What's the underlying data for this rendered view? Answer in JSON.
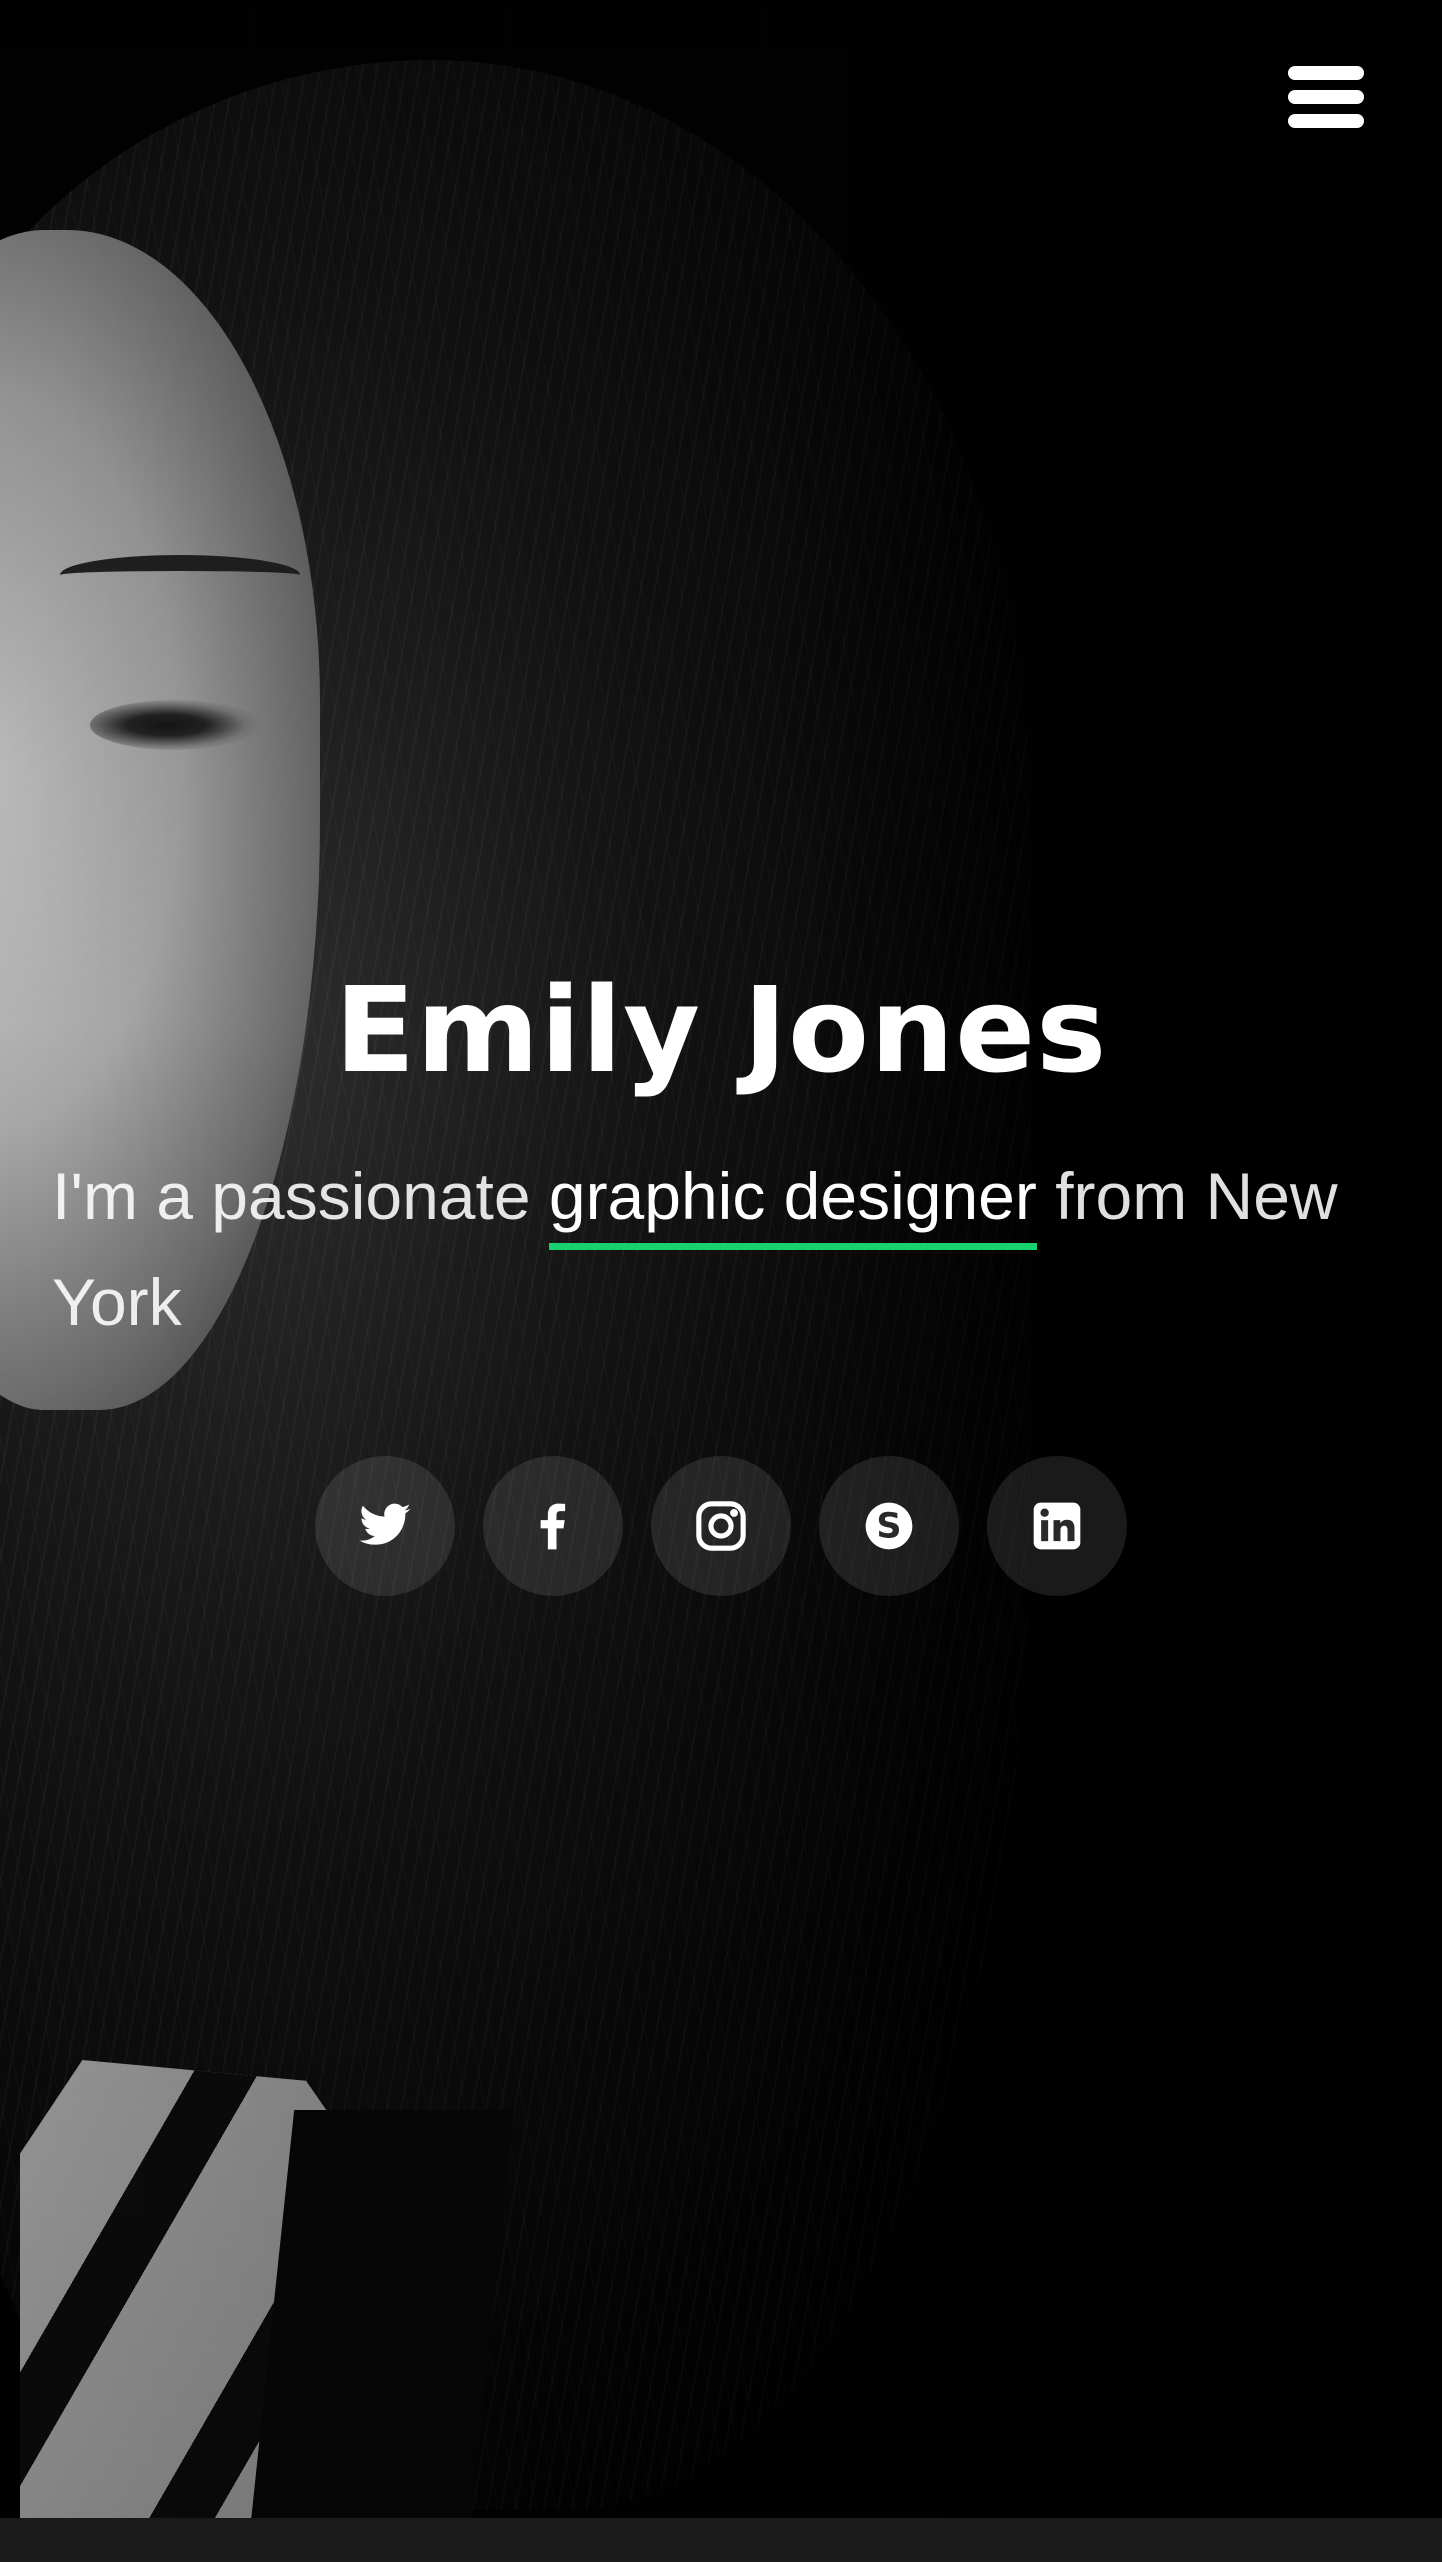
{
  "hero": {
    "name": "Emily Jones",
    "tagline_prefix": "I'm a passionate ",
    "tagline_highlight": "graphic designer",
    "tagline_suffix": " from New York",
    "accent_color": "#18d26e"
  },
  "social": [
    {
      "network": "twitter",
      "icon": "twitter-icon"
    },
    {
      "network": "facebook",
      "icon": "facebook-icon"
    },
    {
      "network": "instagram",
      "icon": "instagram-icon"
    },
    {
      "network": "skype",
      "icon": "skype-icon"
    },
    {
      "network": "linkedin",
      "icon": "linkedin-icon"
    }
  ],
  "nav": {
    "menu_icon": "hamburger-menu-icon"
  },
  "colors": {
    "background": "#000000",
    "text": "#ffffff",
    "accent": "#18d26e"
  }
}
